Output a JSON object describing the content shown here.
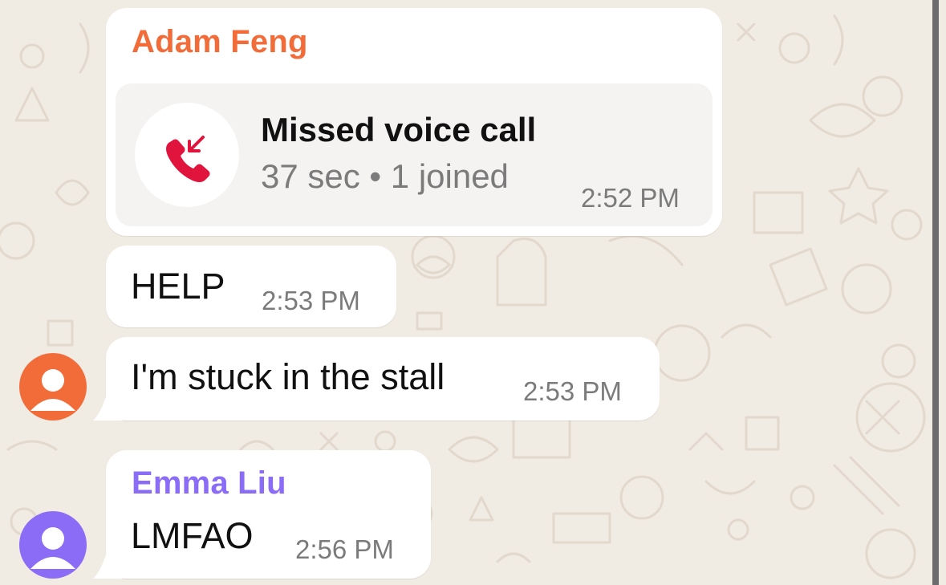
{
  "colors": {
    "adam_accent": "#f26c3a",
    "emma_accent": "#8b6cf6",
    "missed_call_red": "#e0143c",
    "timestamp_gray": "#7b7b7b"
  },
  "messages": {
    "call": {
      "sender": "Adam Feng",
      "title": "Missed voice call",
      "subtitle": "37 sec • 1 joined",
      "time": "2:52 PM",
      "icon": "missed-call-icon"
    },
    "help": {
      "text": "HELP",
      "time": "2:53 PM"
    },
    "stuck": {
      "text": "I'm stuck in the stall",
      "time": "2:53 PM"
    },
    "emma": {
      "sender": "Emma Liu",
      "text": "LMFAO",
      "time": "2:56 PM"
    }
  },
  "avatars": {
    "adam": {
      "icon": "person-icon",
      "color": "#f26c3a"
    },
    "emma": {
      "icon": "person-icon",
      "color": "#8b6cf6"
    }
  }
}
